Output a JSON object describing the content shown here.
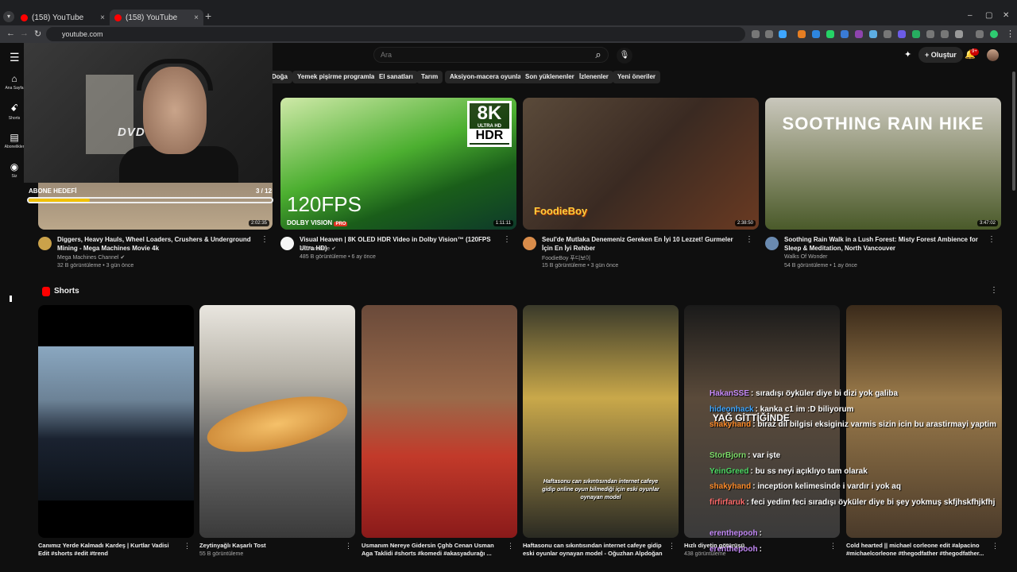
{
  "browser": {
    "tabs": [
      {
        "label": "(158) YouTube",
        "close": "×"
      },
      {
        "label": "(158) YouTube",
        "close": "×"
      }
    ],
    "new_tab": "+",
    "url": "youtube.com",
    "window_controls": {
      "minimize": "–",
      "maximize": "▢",
      "close": "✕"
    }
  },
  "header": {
    "search_placeholder": "Ara",
    "create_label": "Oluştur",
    "notification_count": "9+"
  },
  "rail": [
    {
      "label": "Ana Sayfa",
      "icon": "home-icon"
    },
    {
      "label": "Shorts",
      "icon": "shorts-icon"
    },
    {
      "label": "Abonelikler",
      "icon": "subscriptions-icon"
    },
    {
      "label": "Siz",
      "icon": "you-icon"
    }
  ],
  "chips": [
    "Doğa",
    "Yemek pişirme programları",
    "El sanatları",
    "Tarım",
    "Aksiyon-macera oyunları",
    "Son yüklenenler",
    "İzlenenler",
    "Yeni öneriler"
  ],
  "overlay": {
    "dvd_logo": "DVD",
    "subscriber_goal_label": "ABONE HEDEFİ",
    "subscriber_goal_count": "3 / 12",
    "subscriber_goal_progress": 0.25
  },
  "videos": [
    {
      "title": "Diggers, Heavy Hauls, Wheel Loaders, Crushers & Underground Mining - Mega Machines Movie 4k",
      "channel": "Mega Machines Channel ✔",
      "meta": "32 B görüntüleme • 3 gün önce",
      "duration": "2:02:35",
      "avatar_color": "#caa24a"
    },
    {
      "title": "Visual Heaven | 8K OLED HDR Video in Dolby Vision™ (120FPS Ultra HD)",
      "channel": "8K Paradise ✔",
      "meta": "485 B görüntüleme • 6 ay önce",
      "duration": "1:11:11",
      "avatar_color": "#f5f5f5",
      "badge": {
        "res": "8K",
        "sub": "ULTRA HD",
        "hdr": "HDR"
      },
      "fps_text": "120FPS",
      "dolby_text": "DOLBY VISION",
      "pro_text": "PRO"
    },
    {
      "title": "Seul'de Mutlaka Denemeniz Gereken En İyi 10 Lezzet! Gurmeler İçin En İyi Rehber",
      "channel": "FoodieBoy 푸디보이",
      "meta": "15 B görüntüleme • 3 gün önce",
      "duration": "2:38:50",
      "avatar_color": "#d98c4a",
      "brand": "FoodieBoy"
    },
    {
      "title": "Soothing Rain Walk in a Lush Forest: Misty Forest Ambience for Sleep & Meditation, North Vancouver",
      "channel": "Walks Of Wonder",
      "meta": "54 B görüntüleme • 1 ay önce",
      "duration": "3:47:02",
      "avatar_color": "#6a8ab0",
      "overlay_text": "SOOTHING RAIN HIKE"
    }
  ],
  "shorts": {
    "heading": "Shorts",
    "items": [
      {
        "title": "Canımız Yerde Kalmadı Kardeş | Kurtlar Vadisi Edit #shorts #edit #trend",
        "views": ""
      },
      {
        "title": "Zeytinyağlı Kaşarlı Tost",
        "views": "55 B görüntüleme"
      },
      {
        "title": "Usmanım Nereye Gidersin Çghb Cenan Usman Aga Taklidi #shorts #komedi #akasyadurağı ...",
        "views": ""
      },
      {
        "title": "Haftasonu can sıkıntısından internet cafeye gidip eski oyunlar oynayan model - Oğuzhan Alpdoğan",
        "views": "",
        "caption": "Haftasonu can sıkıntısından internet cafeye gidip online oyun bilmediği için eski oyunlar oynayan model"
      },
      {
        "title": "Hızlı diyetin götürüsü",
        "views": "438 görüntüleme"
      },
      {
        "title": "Cold hearted || michael corleone edit #alpacino #michaelcorleone #thegodfather #thegodfather...",
        "views": ""
      }
    ]
  },
  "chat": {
    "overlay_caption": "YAĞ GİTTİĞİNDE",
    "messages": [
      {
        "user": "HakanSSE",
        "color": "#c58af9",
        "text": ": sıradışı öyküler diye bi dizi yok galiba"
      },
      {
        "user": "hideonhack",
        "color": "#3ea6ff",
        "text": ": kanka c1 im :D biliyorum"
      },
      {
        "user": "shakyhand",
        "color": "#ff8c2a",
        "text": ": biraz dil bilgisi eksiginiz varmis sizin icin bu arastirmayi yaptim"
      },
      {
        "user": "StorBjorn",
        "color": "#7ddc6a",
        "text": ": var işte"
      },
      {
        "user": "YeinGreed",
        "color": "#4cd964",
        "text": ": bu ss neyi açıklıyo tam olarak"
      },
      {
        "user": "shakyhand",
        "color": "#ff8c2a",
        "text": ": inception kelimesinde i vardır i yok aq"
      },
      {
        "user": "firfirfaruk",
        "color": "#ff6a6a",
        "text": ": feci yedim feci sıradışı öyküler diye bi şey yokmuş skfjhskfhjkfhj"
      },
      {
        "user": "erenthepooh",
        "color": "#c58af9",
        "text": ":"
      },
      {
        "user": "erenthepooh",
        "color": "#c58af9",
        "text": ":"
      }
    ]
  }
}
